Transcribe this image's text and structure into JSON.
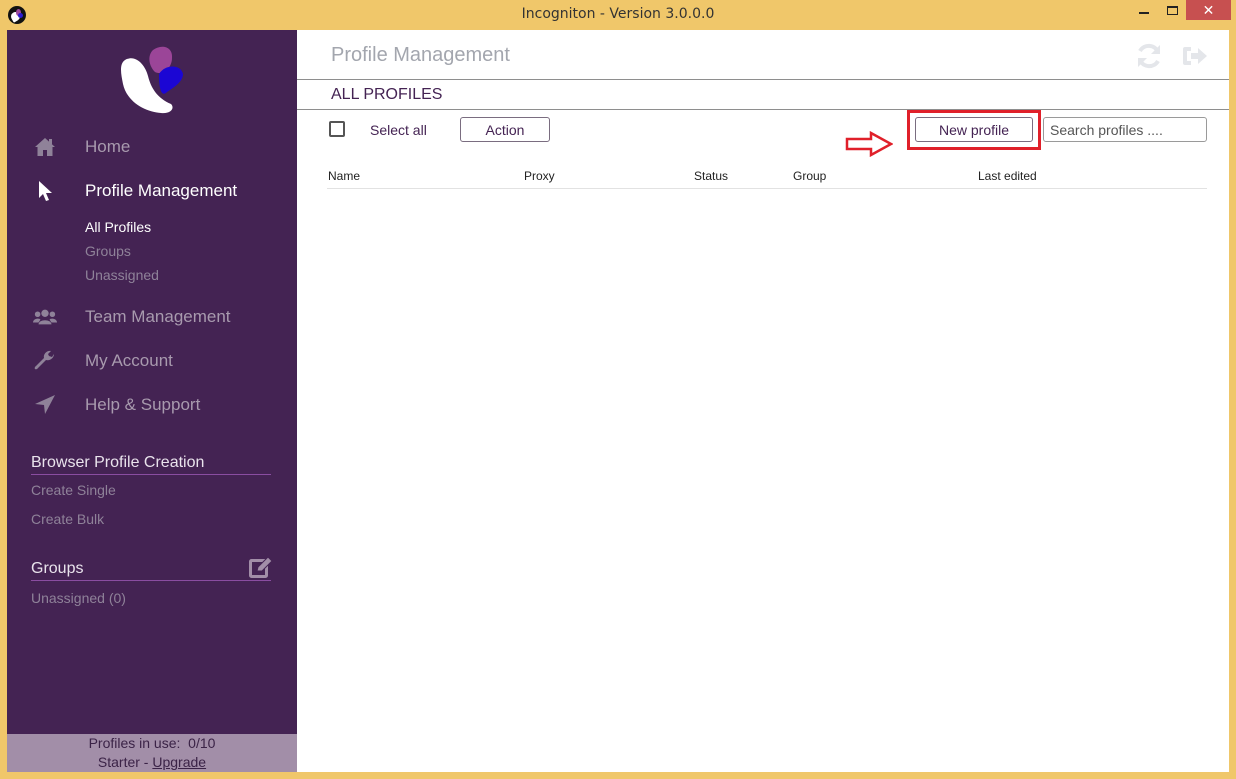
{
  "window": {
    "title": "Incogniton - Version 3.0.0.0",
    "minimize_icon": "minimize-icon",
    "maximize_icon": "maximize-icon",
    "close_label": "✕"
  },
  "sidebar": {
    "nav": [
      {
        "label": "Home",
        "icon": "home-icon",
        "active": false
      },
      {
        "label": "Profile Management",
        "icon": "cursor-pointer-icon",
        "active": true
      },
      {
        "label": "Team Management",
        "icon": "users-icon",
        "active": false
      },
      {
        "label": "My Account",
        "icon": "wrench-icon",
        "active": false
      },
      {
        "label": "Help & Support",
        "icon": "paper-plane-icon",
        "active": false
      }
    ],
    "profile_subnav": [
      {
        "label": "All Profiles",
        "active": true
      },
      {
        "label": "Groups",
        "active": false
      },
      {
        "label": "Unassigned",
        "active": false
      }
    ],
    "browser_profile_creation": {
      "title": "Browser Profile Creation",
      "links": [
        "Create Single",
        "Create Bulk"
      ]
    },
    "groups": {
      "title": "Groups",
      "edit_icon": "edit-icon",
      "items": [
        "Unassigned (0)"
      ]
    },
    "footer": {
      "profiles_in_use_label": "Profiles in use:",
      "profiles_in_use_value": "0/10",
      "plan": "Starter -",
      "upgrade_link": "Upgrade"
    }
  },
  "main": {
    "page_title": "Profile Management",
    "section_title": "ALL PROFILES",
    "select_all_label": "Select all",
    "select_all_checked": false,
    "action_button": "Action",
    "new_profile_button": "New profile",
    "search_placeholder": "Search profiles ....",
    "search_value": "",
    "columns": [
      "Name",
      "Proxy",
      "Status",
      "Group",
      "Last edited"
    ],
    "rows": [],
    "annotation": {
      "highlight_color": "#e0202a",
      "arrow_target": "New profile"
    }
  },
  "colors": {
    "titlebar": "#f0c76a",
    "sidebar_bg": "#442353",
    "sidebar_footer": "#a28ea8",
    "accent_text": "#442353",
    "close_button": "#c75050"
  }
}
